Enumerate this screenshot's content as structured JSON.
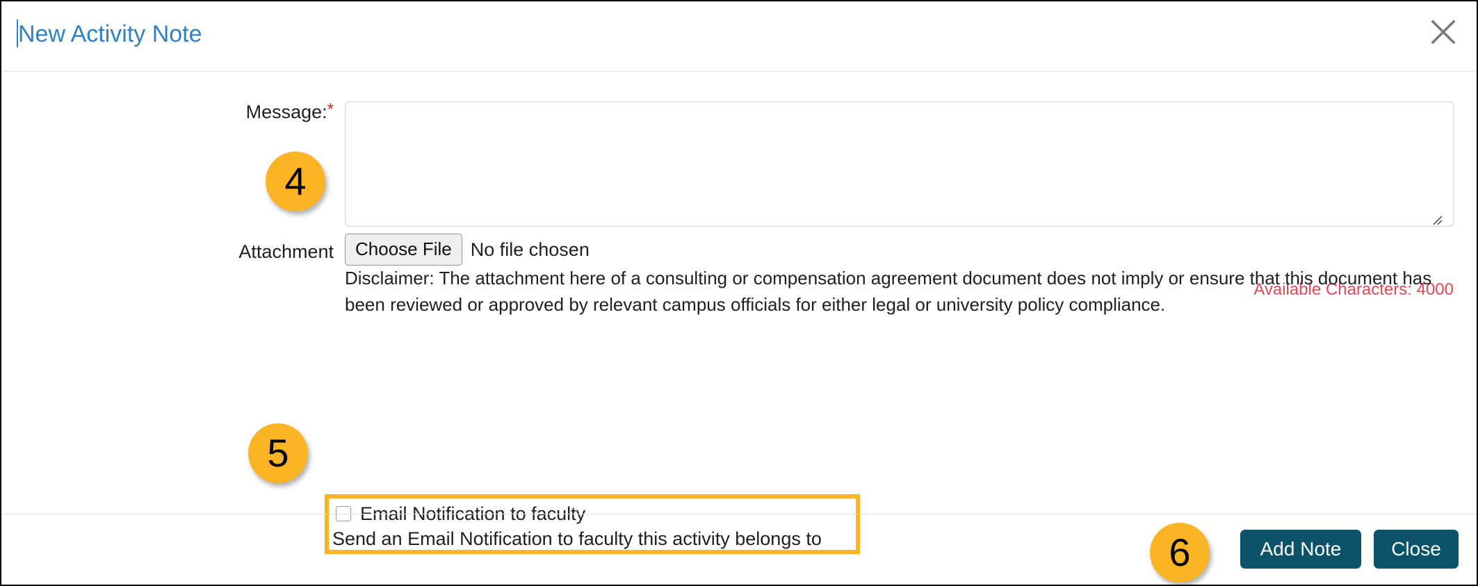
{
  "dialog": {
    "title": "New Activity Note",
    "close_icon": "close-icon"
  },
  "form": {
    "message": {
      "label": "Message:",
      "required_marker": "*",
      "value": "",
      "placeholder": ""
    },
    "available_characters": "Available Characters: 4000",
    "attachment": {
      "label": "Attachment",
      "choose_file_label": "Choose File",
      "file_status": "No file chosen",
      "disclaimer": "Disclaimer: The attachment here of a consulting or compensation agreement document does not imply or ensure that this document has been reviewed or approved by relevant campus officials for either legal or university policy compliance."
    },
    "email_notification": {
      "checkbox_label": "Email Notification to faculty",
      "description": "Send an Email Notification to faculty this activity belongs to",
      "checked": false
    }
  },
  "footer": {
    "add_note_label": "Add Note",
    "close_label": "Close"
  },
  "annotations": {
    "badges": [
      {
        "number": "4"
      },
      {
        "number": "5"
      },
      {
        "number": "6"
      }
    ]
  },
  "colors": {
    "title_blue": "#3280c4",
    "badge_orange": "#fab424",
    "highlight_orange": "#fab424",
    "button_teal": "#0c5369",
    "required_red": "#e02020",
    "counter_red": "#e04a56"
  }
}
